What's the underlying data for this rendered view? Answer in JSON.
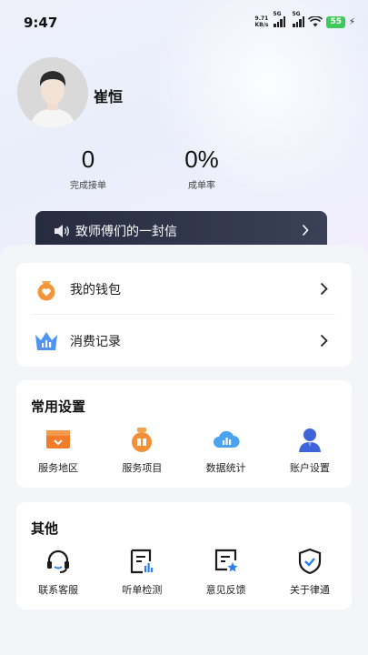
{
  "status_bar": {
    "time": "9:47",
    "net_speed_value": "9.71",
    "net_speed_unit": "KB/s",
    "signal1": "5G",
    "signal2": "5G",
    "battery": "55"
  },
  "profile": {
    "name": "崔恒",
    "stats": [
      {
        "value": "0",
        "label": "完成接单"
      },
      {
        "value": "0%",
        "label": "成单率"
      }
    ]
  },
  "banner": {
    "text": "致师傅们的一封信"
  },
  "menu": [
    {
      "label": "我的钱包",
      "icon": "wallet-icon"
    },
    {
      "label": "消费记录",
      "icon": "crown-chart-icon"
    }
  ],
  "common_settings": {
    "title": "常用设置",
    "items": [
      {
        "label": "服务地区",
        "icon": "region-box-icon"
      },
      {
        "label": "服务项目",
        "icon": "gift-bag-icon"
      },
      {
        "label": "数据统计",
        "icon": "cloud-chart-icon"
      },
      {
        "label": "账户设置",
        "icon": "user-icon"
      }
    ]
  },
  "others": {
    "title": "其他",
    "items": [
      {
        "label": "联系客服",
        "icon": "headset-icon"
      },
      {
        "label": "听单检测",
        "icon": "document-chart-icon"
      },
      {
        "label": "意见反馈",
        "icon": "feedback-star-icon"
      },
      {
        "label": "关于律通",
        "icon": "shield-check-icon"
      }
    ]
  },
  "colors": {
    "accent_orange": "#f08a2e",
    "accent_blue": "#3a7bea",
    "banner_dark": "#2b3045",
    "battery_green": "#3ecb5b"
  }
}
